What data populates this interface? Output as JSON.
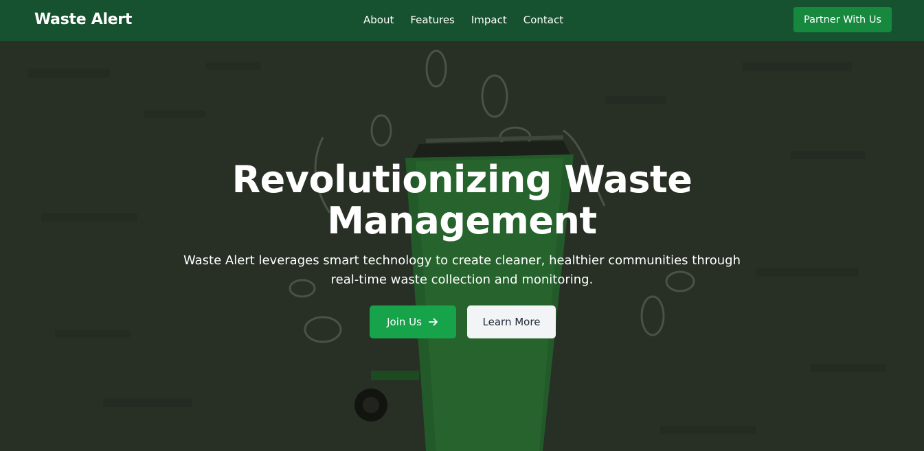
{
  "nav": {
    "brand": "Waste Alert",
    "links": [
      "About",
      "Features",
      "Impact",
      "Contact"
    ],
    "cta": "Partner With Us"
  },
  "hero": {
    "headline_line1": "Revolutionizing Waste",
    "headline_line2": "Management",
    "subtitle": "Waste Alert leverages smart technology to create cleaner, healthier communities through real-time waste collection and monitoring.",
    "primary_button": "Join Us",
    "primary_icon": "arrow-right-icon",
    "secondary_button": "Learn More"
  },
  "colors": {
    "nav_bg": "#175230",
    "accent": "#16a34a",
    "partner_bg": "#17893e",
    "hero_overlay": "#283026",
    "light_button": "#f3f4f6"
  }
}
